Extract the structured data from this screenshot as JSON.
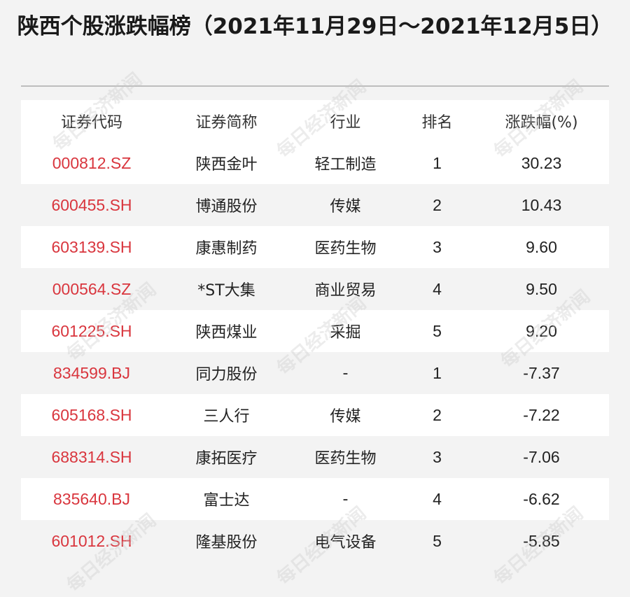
{
  "title": "陕西个股涨跌幅榜（2021年11月29日～2021年12月5日）",
  "watermark": "每日经济新闻",
  "colors": {
    "code": "#d9363e",
    "row_alt": "#f3f3f3"
  },
  "table": {
    "headers": [
      "证券代码",
      "证券简称",
      "行业",
      "排名",
      "涨跌幅(%)"
    ],
    "rows": [
      [
        "000812.SZ",
        "陕西金叶",
        "轻工制造",
        "1",
        "30.23"
      ],
      [
        "600455.SH",
        "博通股份",
        "传媒",
        "2",
        "10.43"
      ],
      [
        "603139.SH",
        "康惠制药",
        "医药生物",
        "3",
        "9.60"
      ],
      [
        "000564.SZ",
        "*ST大集",
        "商业贸易",
        "4",
        "9.50"
      ],
      [
        "601225.SH",
        "陕西煤业",
        "采掘",
        "5",
        "9.20"
      ],
      [
        "834599.BJ",
        "同力股份",
        "-",
        "1",
        "-7.37"
      ],
      [
        "605168.SH",
        "三人行",
        "传媒",
        "2",
        "-7.22"
      ],
      [
        "688314.SH",
        "康拓医疗",
        "医药生物",
        "3",
        "-7.06"
      ],
      [
        "835640.BJ",
        "富士达",
        "-",
        "4",
        "-6.62"
      ],
      [
        "601012.SH",
        "隆基股份",
        "电气设备",
        "5",
        "-5.85"
      ]
    ]
  }
}
